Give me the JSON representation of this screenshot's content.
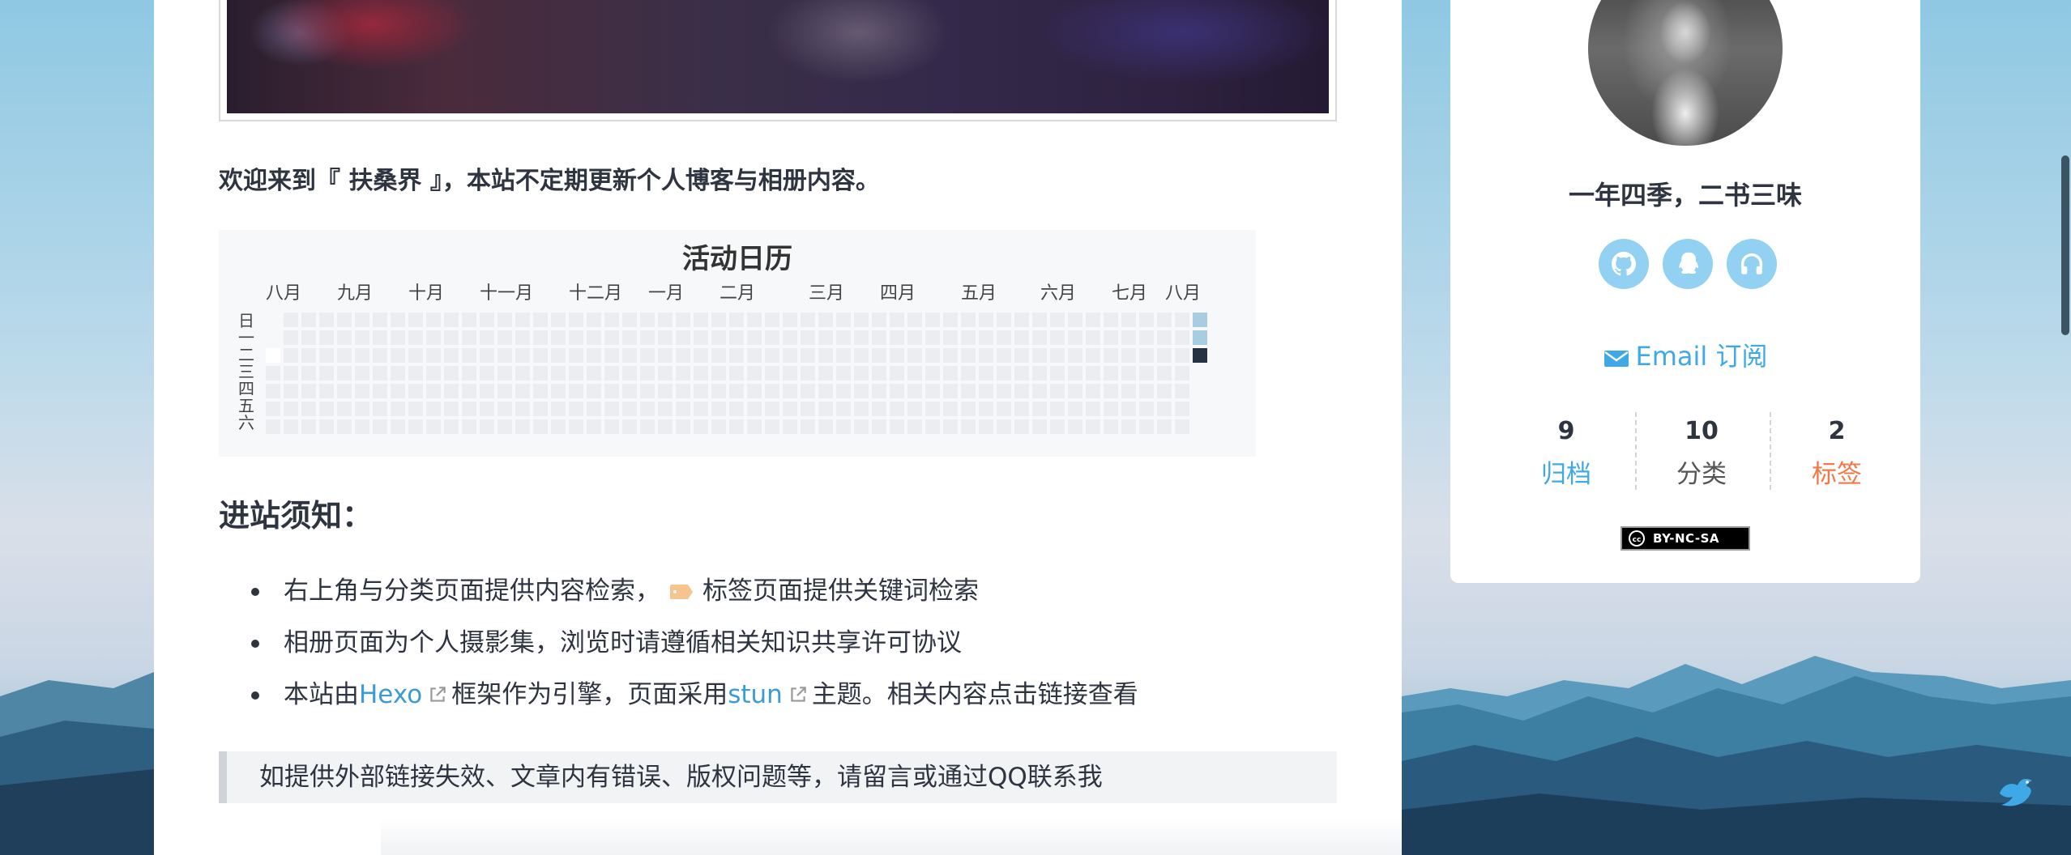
{
  "colors": {
    "accent_blue": "#3fa9e8",
    "archive_label": "#3fa9e8",
    "category_label": "#555555",
    "tag_label": "#f2784b",
    "social_icon_bg": "#92d1f2",
    "calendar_empty": "#ebedf0",
    "calendar_light": "#a9cde0",
    "calendar_dark": "#263241"
  },
  "main": {
    "welcome": "欢迎来到『 扶桑界 』，本站不定期更新个人博客与相册内容。",
    "calendar": {
      "title": "活动日历",
      "months": [
        "八月",
        "九月",
        "十月",
        "十一月",
        "十二月",
        "一月",
        "二月",
        "三月",
        "四月",
        "五月",
        "六月",
        "七月",
        "八月"
      ],
      "weekdays": [
        "日",
        "一",
        "二",
        "三",
        "四",
        "五",
        "六"
      ]
    },
    "notice_title": "进站须知：",
    "notices": {
      "item1_before": "右上角与分类页面提供内容检索，",
      "item1_after": "标签页面提供关键词检索",
      "item2": "相册页面为个人摄影集，浏览时请遵循相关知识共享许可协议",
      "item3_prefix": "本站由",
      "item3_link1": "Hexo",
      "item3_mid": "框架作为引擎，页面采用",
      "item3_link2": "stun",
      "item3_suffix": "主题。相关内容点击链接查看"
    },
    "quote": "如提供外部链接失效、文章内有错误、版权问题等，请留言或通过QQ联系我"
  },
  "sidebar": {
    "motto": "一年四季，二书三味",
    "social_icons": [
      "github-icon",
      "qq-icon",
      "headphones-icon"
    ],
    "email_subscribe": "Email 订阅",
    "stats": [
      {
        "count": "9",
        "label": "归档"
      },
      {
        "count": "10",
        "label": "分类"
      },
      {
        "count": "2",
        "label": "标签"
      }
    ],
    "license": "BY-NC-SA"
  }
}
